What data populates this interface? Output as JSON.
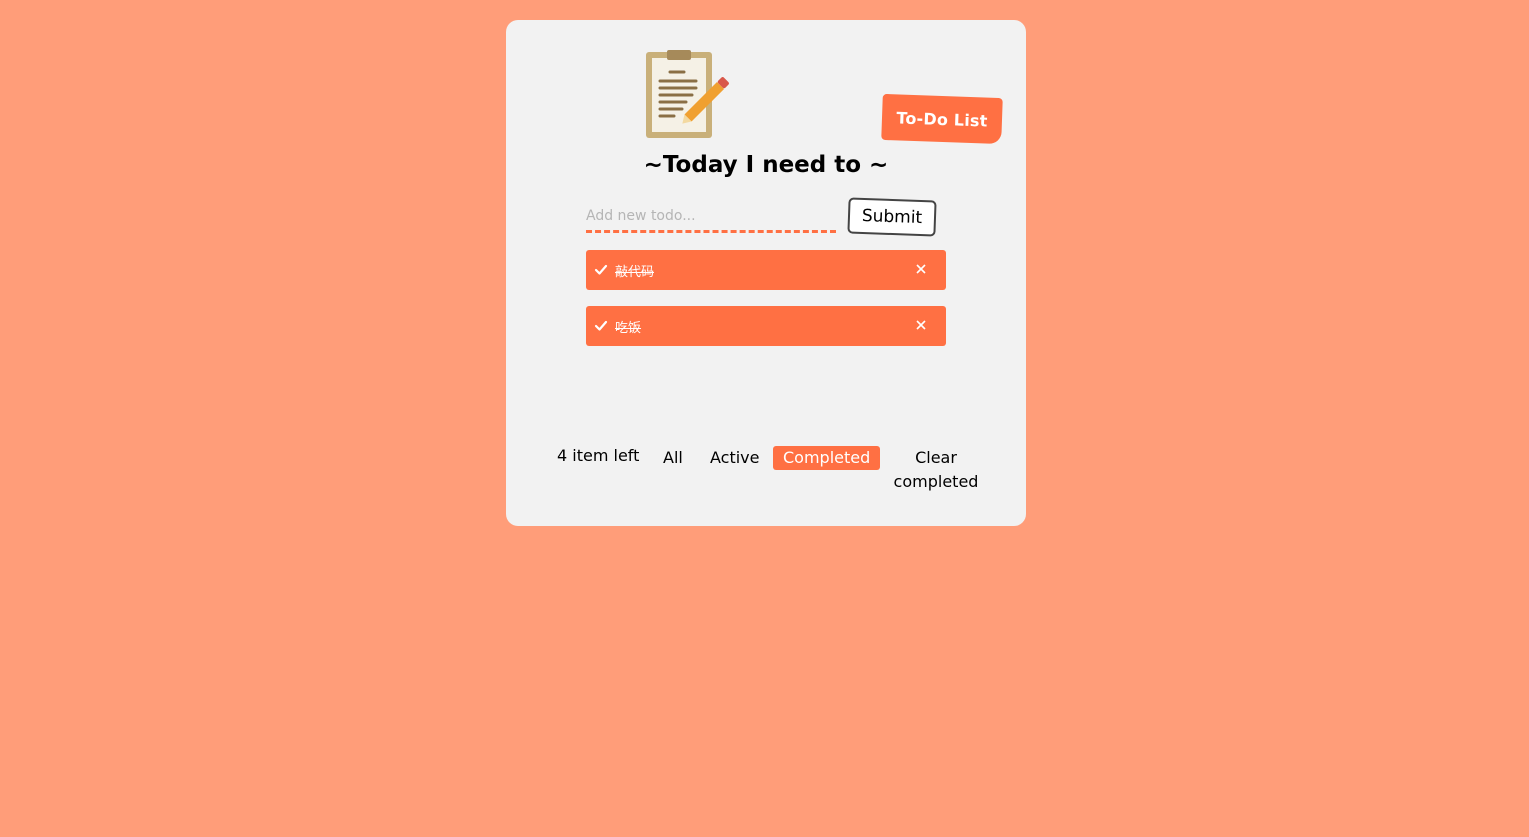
{
  "header": {
    "logo_tag": "To-Do List",
    "title": "~Today I need to ~"
  },
  "new_todo": {
    "placeholder": "Add new todo...",
    "value": "",
    "submit_label": "Submit"
  },
  "todos": [
    {
      "text": "敲代码",
      "completed": true
    },
    {
      "text": "吃饭",
      "completed": true
    }
  ],
  "footer": {
    "count_label": "4 item left",
    "filters": [
      {
        "label": "All",
        "selected": false
      },
      {
        "label": "Active",
        "selected": false
      },
      {
        "label": "Completed",
        "selected": true
      }
    ],
    "clear_line1": "Clear",
    "clear_line2": "completed"
  },
  "colors": {
    "background": "#ff9d79",
    "card": "#f2f2f2",
    "accent": "#ff7043"
  },
  "icons": {
    "logo": "clipboard-pencil-icon",
    "check": "check-icon",
    "delete": "close-icon"
  }
}
